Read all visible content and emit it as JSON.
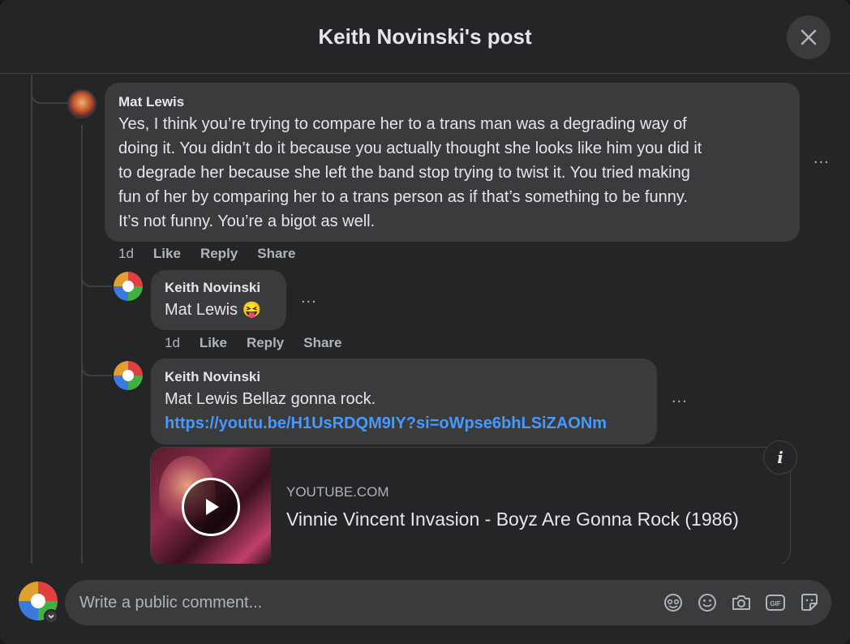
{
  "header": {
    "title": "Keith Novinski's post"
  },
  "comments": [
    {
      "author": "Mat Lewis",
      "text_lines": [
        "Yes, I think you’re trying to compare her to a trans man was a degrading way of",
        "doing it. You didn’t do it because you actually thought she looks like him you did it",
        "to degrade her because she left the band stop trying to twist it. You tried making",
        "fun of her by comparing her to a trans person as if that’s something to be funny.",
        "It’s not funny. You’re a bigot as well."
      ],
      "time": "1d",
      "like": "Like",
      "reply": "Reply",
      "share": "Share",
      "more": "..."
    },
    {
      "author": "Keith Novinski",
      "text": "Mat Lewis",
      "emoji": "😝",
      "time": "1d",
      "like": "Like",
      "reply": "Reply",
      "share": "Share",
      "more": "..."
    },
    {
      "author": "Keith Novinski",
      "text": "Mat Lewis Bellaz gonna rock.",
      "link": "https://youtu.be/H1UsRDQM9IY?si=oWpse6bhLSiZAONm",
      "more": "...",
      "preview": {
        "domain": "YOUTUBE.COM",
        "title": "Vinnie Vincent Invasion - Boyz Are Gonna Rock (1986)",
        "info": "i"
      }
    }
  ],
  "composer": {
    "placeholder": "Write a public comment...",
    "icons": [
      "avatar-sticker-icon",
      "emoji-icon",
      "camera-icon",
      "gif-icon",
      "sticker-icon"
    ]
  },
  "colors": {
    "background": "#242526",
    "bubble": "#3a3b3c",
    "link": "#4599ff",
    "muted": "#b0b3b8"
  }
}
